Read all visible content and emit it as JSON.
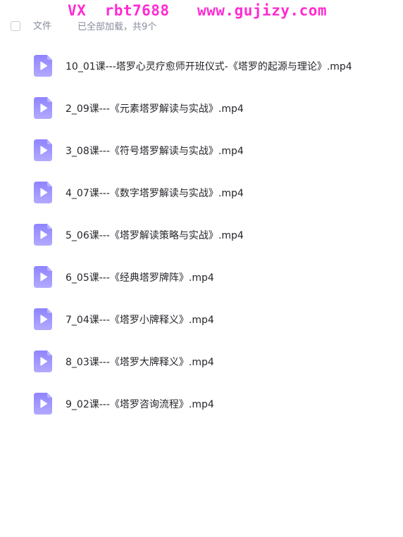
{
  "watermark": "VX  rbt7688   www.gujizy.com",
  "header": {
    "column_label": "文件",
    "load_status": "已全部加载，共9个"
  },
  "colors": {
    "watermark": "#ff2bd2",
    "icon_fill_top": "#8f84ff",
    "icon_fill_bottom": "#b2aaff",
    "muted_text": "#878c9c"
  },
  "files": [
    {
      "name": "10_01课---塔罗心灵疗愈师开班仪式-《塔罗的起源与理论》.mp4",
      "icon": "video-file-icon"
    },
    {
      "name": "2_09课---《元素塔罗解读与实战》.mp4",
      "icon": "video-file-icon"
    },
    {
      "name": "3_08课---《符号塔罗解读与实战》.mp4",
      "icon": "video-file-icon"
    },
    {
      "name": "4_07课---《数字塔罗解读与实战》.mp4",
      "icon": "video-file-icon"
    },
    {
      "name": "5_06课---《塔罗解读策略与实战》.mp4",
      "icon": "video-file-icon"
    },
    {
      "name": "6_05课---《经典塔罗牌阵》.mp4",
      "icon": "video-file-icon"
    },
    {
      "name": "7_04课---《塔罗小牌释义》.mp4",
      "icon": "video-file-icon"
    },
    {
      "name": "8_03课---《塔罗大牌释义》.mp4",
      "icon": "video-file-icon"
    },
    {
      "name": "9_02课---《塔罗咨询流程》.mp4",
      "icon": "video-file-icon"
    }
  ]
}
